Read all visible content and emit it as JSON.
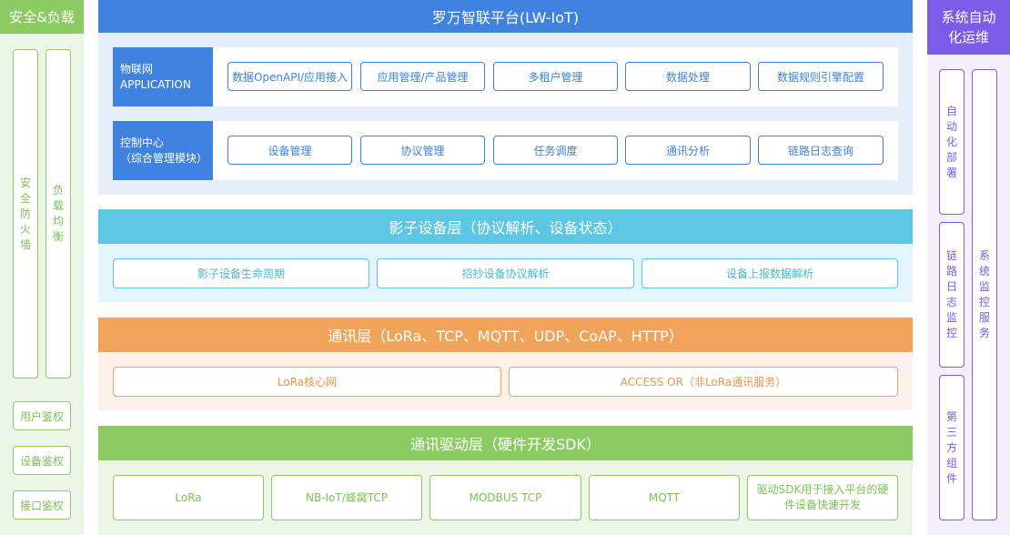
{
  "left": {
    "title": "安全&负载",
    "firewall": [
      "安",
      "全",
      "防",
      "火",
      "墙"
    ],
    "load_balance": [
      "负",
      "载",
      "均",
      "衡"
    ],
    "auth_buttons": [
      "用户鉴权",
      "设备鉴权",
      "接口鉴权"
    ]
  },
  "right": {
    "title_line1": "系统自动",
    "title_line2": "化运维",
    "auto_deploy": [
      "自",
      "动",
      "化",
      "部",
      "署"
    ],
    "link_log": [
      "链",
      "路",
      "日",
      "志",
      "监",
      "控"
    ],
    "third_party": [
      "第",
      "三",
      "方",
      "组",
      "件"
    ],
    "monitor": [
      "系",
      "统",
      "监",
      "控",
      "服",
      "务"
    ]
  },
  "platform": {
    "title": "罗万智联平台(LW-IoT)",
    "iot_label_line1": "物联网",
    "iot_label_line2": "APPLICATION",
    "iot_buttons": [
      "数据OpenAPI/应用接入",
      "应用管理/产品管理",
      "多租户管理",
      "数据处理",
      "数据规则引擎配置"
    ],
    "control_label_line1": "控制中心",
    "control_label_line2": "（综合管理模块）",
    "control_buttons": [
      "设备管理",
      "协议管理",
      "任务调度",
      "通讯分析",
      "链路日志查询"
    ]
  },
  "shadow": {
    "title": "影子设备层（协议解析、设备状态）",
    "buttons": [
      "影子设备生命周期",
      "招抄设备协议解析",
      "设备上报数据解析"
    ]
  },
  "comm": {
    "title": "通讯层（LoRa、TCP、MQTT、UDP、CoAP、HTTP）",
    "buttons": [
      "LoRa核心网",
      "ACCESS OR（非LoRa通讯服务）"
    ]
  },
  "driver": {
    "title": "通讯驱动层（硬件开发SDK）",
    "buttons": [
      "LoRa",
      "NB-IoT/蜂窝TCP",
      "MODBUS TCP",
      "MQTT"
    ],
    "sdk_line1": "驱动SDK用于接入平台的硬",
    "sdk_line2": "件设备快速开发"
  }
}
